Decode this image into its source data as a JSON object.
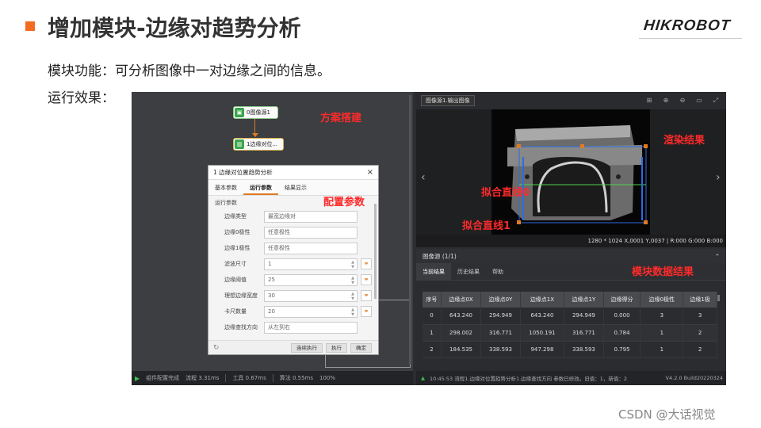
{
  "slide": {
    "title": "增加模块-边缘对趋势分析",
    "logo": "HIKROBOT",
    "description": "模块功能：可分析图像中一对边缘之间的信息。",
    "run_effect_label": "运行效果：",
    "footer": "CSDN @大话视觉",
    "accent_color": "#f26b21"
  },
  "flow": {
    "node1_label": "0图像源1",
    "node2_label": "1边缘对位...",
    "node1_icon": "image-source-icon",
    "node2_icon": "edge-pair-icon"
  },
  "annotations": {
    "scheme": "方案搭建",
    "config": "配置参数",
    "render": "渲染结果",
    "data": "模块数据结果",
    "line0": "拟合直线0",
    "line1": "拟合直线1",
    "color": "#ff2a2a"
  },
  "dialog": {
    "title": "1 边缘对位置趋势分析",
    "close_icon": "×",
    "tabs": [
      "基本参数",
      "运行参数",
      "结果显示"
    ],
    "active_tab": "运行参数",
    "section": "运行参数",
    "params": [
      {
        "label": "边缘类型",
        "value": "最宽边缘对"
      },
      {
        "label": "边缘0极性",
        "value": "任意极性"
      },
      {
        "label": "边缘1极性",
        "value": "任意极性"
      },
      {
        "label": "滤波尺寸",
        "value": "1"
      },
      {
        "label": "边缘阈值",
        "value": "25"
      },
      {
        "label": "理想边缘宽度",
        "value": "30"
      },
      {
        "label": "卡尺数量",
        "value": "20"
      },
      {
        "label": "边缘查找方向",
        "value": "从左到右"
      }
    ],
    "buttons": {
      "continuous": "连续执行",
      "run": "执行",
      "ok": "确定"
    }
  },
  "status_left": {
    "state": "组件配置完成",
    "flow_time": "流程 3.31ms",
    "tool_time": "工具 0.67ms",
    "algo_time": "算法 0.55ms",
    "zoom": "100%"
  },
  "image_panel": {
    "source": "图像源1.输出图像",
    "info": "1280 * 1024    X,0001 Y,0037 | R:000 G:000 B:000"
  },
  "results": {
    "title": "图像源 (1/1)",
    "tabs": [
      "当前结果",
      "历史结果",
      "帮助"
    ],
    "active_tab": "当前结果",
    "columns": [
      "序号",
      "边缘点0X",
      "边缘点0Y",
      "边缘点1X",
      "边缘点1Y",
      "边缘得分",
      "边缘0极性",
      "边缘1极"
    ],
    "rows": [
      [
        "0",
        "643.240",
        "294.949",
        "643.240",
        "294.949",
        "0.000",
        "3",
        "3"
      ],
      [
        "1",
        "298.002",
        "316.771",
        "1050.191",
        "316.771",
        "0.784",
        "1",
        "2"
      ],
      [
        "2",
        "184.535",
        "338.593",
        "947.298",
        "338.593",
        "0.795",
        "1",
        "2"
      ]
    ],
    "log": "10:45:53  流程1.边缘对位置趋势分析1.边缘查找方向 参数已修改。旧值：1，新值：2",
    "version": "V4.2.0 Build20220324"
  }
}
